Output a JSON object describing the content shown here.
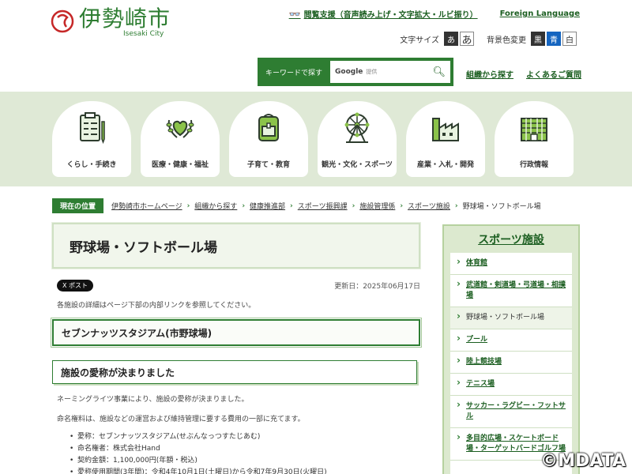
{
  "header": {
    "logo_text": "伊勢崎市",
    "logo_sub": "Isesaki City",
    "accessibility_link": "閲覧支援（音声読み上げ・文字拡大・ルビ振り）",
    "foreign_language": "Foreign Language",
    "text_size_label": "文字サイズ",
    "text_size_small": "あ",
    "text_size_large": "あ",
    "bg_color_label": "背景色変更",
    "bg_black": "黒",
    "bg_blue": "青",
    "bg_white": "白",
    "search_label": "キーワードで探す",
    "search_google": "Google",
    "search_provided": "提供",
    "nav_org": "組織から探す",
    "nav_faq": "よくあるご質問"
  },
  "categories": [
    {
      "label": "くらし・手続き",
      "icon": "clipboard-icon"
    },
    {
      "label": "医療・健康・福祉",
      "icon": "heart-laurel-icon"
    },
    {
      "label": "子育て・教育",
      "icon": "backpack-icon"
    },
    {
      "label": "観光・文化・スポーツ",
      "icon": "ferris-wheel-icon"
    },
    {
      "label": "産業・入札・開発",
      "icon": "factory-icon"
    },
    {
      "label": "行政情報",
      "icon": "city-hall-icon"
    }
  ],
  "breadcrumb": {
    "label": "現在の位置",
    "items": [
      "伊勢崎市ホームページ",
      "組織から探す",
      "健康推進部",
      "スポーツ振興課",
      "施設管理係",
      "スポーツ施設",
      "野球場・ソフトボール場"
    ]
  },
  "main": {
    "title": "野球場・ソフトボール場",
    "post_button": "X ポスト",
    "updated": "更新日：2025年06月17日",
    "note": "各施設の詳細はページ下部の内部リンクを参照してください。",
    "section1_heading": "セブンナッツスタジアム(市野球場)",
    "section2_heading": "施設の愛称が決まりました",
    "para1": "ネーミングライツ事業により、施設の愛称が決まりました。",
    "para2": "命名権料は、施設などの運営および維持管理に要する費用の一部に充てます。",
    "bullets": [
      "愛称：セブンナッツスタジアム(せぶんなっつすたじあむ)",
      "命名権者：株式会社Hand",
      "契約金額：1,100,000円(年額・税込)",
      "愛称使用期間(3年間)：令和4年10月1日(土曜日)から令和7年9月30日(火曜日)"
    ]
  },
  "side": {
    "heading": "スポーツ施設",
    "items": [
      "体育館",
      "武道館・剣道場・弓道場・相撲場",
      "野球場・ソフトボール場",
      "プール",
      "陸上競技場",
      "テニス場",
      "サッカー・ラグビー・フットサル",
      "多目的広場・スケートボード場・ターゲットバードゴルフ場"
    ]
  },
  "watermark": "©MDATA"
}
